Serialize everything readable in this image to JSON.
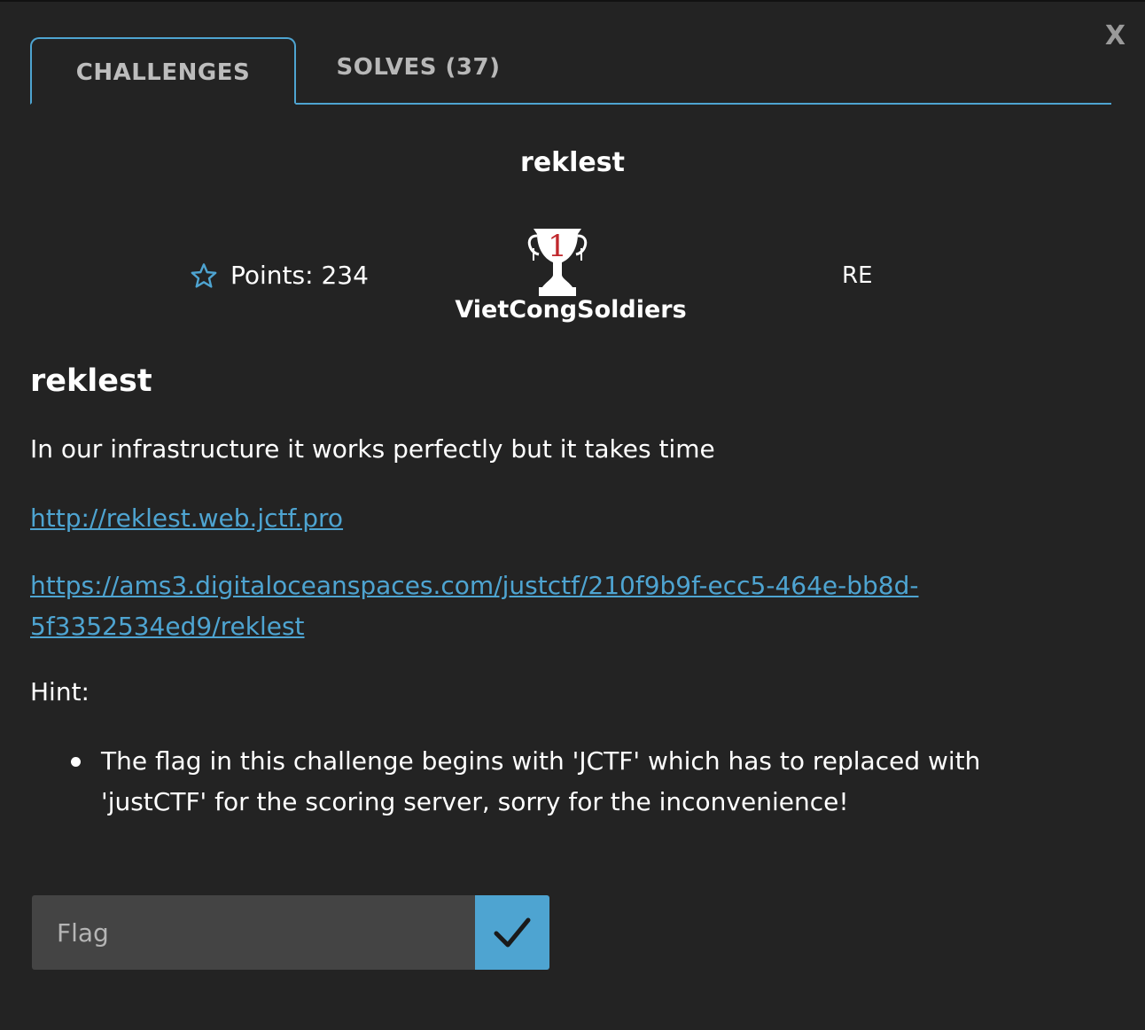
{
  "modal": {
    "close_label": "X"
  },
  "tabs": [
    {
      "label": "CHALLENGES",
      "active": true
    },
    {
      "label": "SOLVES (37)",
      "active": false
    }
  ],
  "challenge": {
    "name": "reklest",
    "points": "Points: 234",
    "first_blood_team": "VietCongSoldiers",
    "first_blood_rank": "1",
    "category": "RE",
    "description_title": "reklest",
    "description": "In our infrastructure it works perfectly but it takes time",
    "links": [
      "http://reklest.web.jctf.pro",
      "https://ams3.digitaloceanspaces.com/justctf/210f9b9f-ecc5-464e-bb8d-5f3352534ed9/reklest"
    ],
    "hint_label": "Hint:",
    "hints": [
      "The flag in this challenge begins with 'JCTF' which has to replaced with 'justCTF' for the scoring server, sorry for the inconvenience!"
    ]
  },
  "flag_form": {
    "placeholder": "Flag",
    "value": ""
  },
  "colors": {
    "background": "#232323",
    "accent": "#4ea4d1",
    "input_bg": "#444444",
    "trophy_number": "#c0282d"
  },
  "icons": {
    "close": "close-icon",
    "star": "star-icon",
    "trophy": "trophy-icon",
    "submit": "checkmark-icon"
  }
}
